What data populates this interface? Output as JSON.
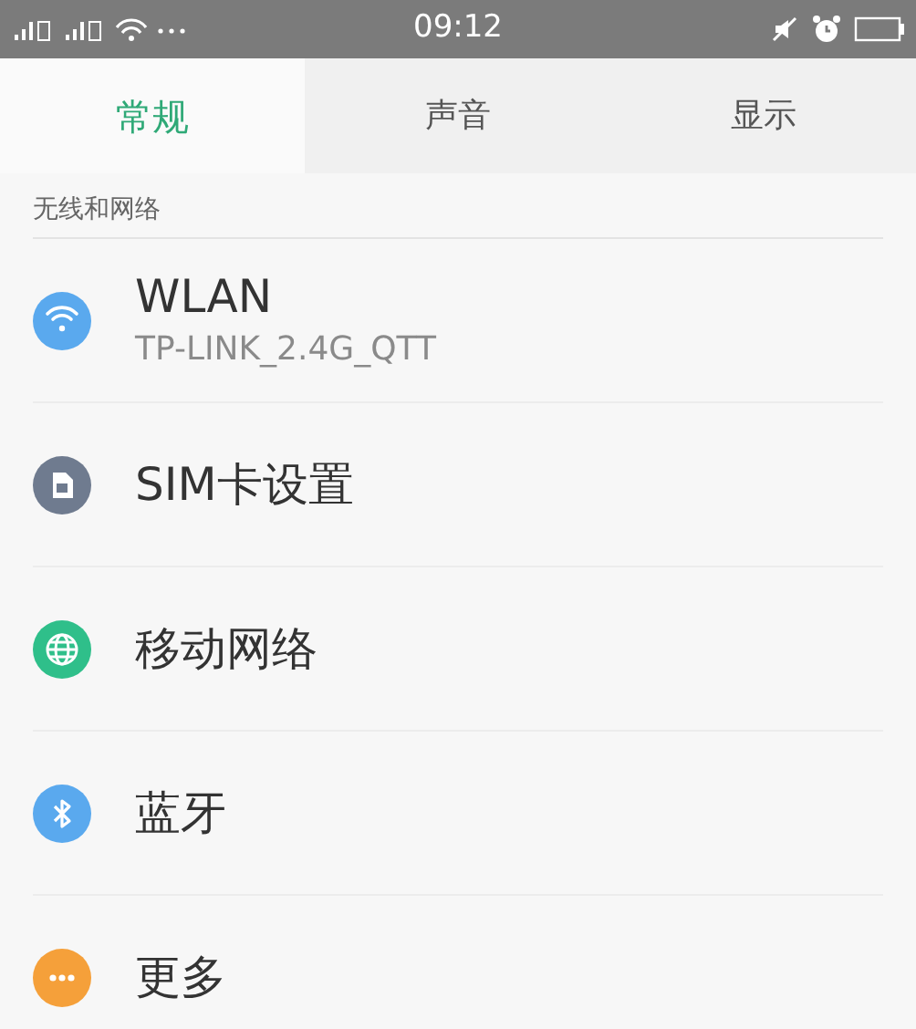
{
  "status_bar": {
    "time": "09:12"
  },
  "tabs": [
    {
      "label": "常规",
      "selected": true
    },
    {
      "label": "声音",
      "selected": false
    },
    {
      "label": "显示",
      "selected": false
    }
  ],
  "section": {
    "title": "无线和网络"
  },
  "items": [
    {
      "kind": "wifi",
      "color": "#5aa9ee",
      "title": "WLAN",
      "subtitle": "TP-LINK_2.4G_QTT"
    },
    {
      "kind": "sim",
      "color": "#6f7b8f",
      "title": "SIM卡设置"
    },
    {
      "kind": "globe",
      "color": "#2fbf8a",
      "title": "移动网络"
    },
    {
      "kind": "bluetooth",
      "color": "#5aa9ee",
      "title": "蓝牙"
    },
    {
      "kind": "more",
      "color": "#f5a03a",
      "title": "更多"
    }
  ]
}
